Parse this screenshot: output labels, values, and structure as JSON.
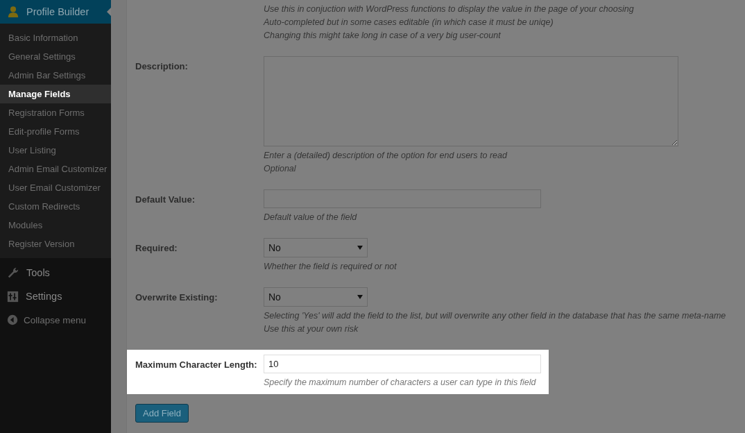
{
  "sidebar": {
    "header": {
      "label": "Profile Builder"
    },
    "items": [
      {
        "label": "Basic Information",
        "selected": false
      },
      {
        "label": "General Settings",
        "selected": false
      },
      {
        "label": "Admin Bar Settings",
        "selected": false
      },
      {
        "label": "Manage Fields",
        "selected": true
      },
      {
        "label": "Registration Forms",
        "selected": false
      },
      {
        "label": "Edit-profile Forms",
        "selected": false
      },
      {
        "label": "User Listing",
        "selected": false
      },
      {
        "label": "Admin Email Customizer",
        "selected": false
      },
      {
        "label": "User Email Customizer",
        "selected": false
      },
      {
        "label": "Custom Redirects",
        "selected": false
      },
      {
        "label": "Modules",
        "selected": false
      },
      {
        "label": "Register Version",
        "selected": false
      }
    ],
    "menu": [
      {
        "label": "Tools",
        "kind": "tools"
      },
      {
        "label": "Settings",
        "kind": "settings"
      },
      {
        "label": "Collapse menu",
        "kind": "collapse"
      }
    ]
  },
  "fields": [
    {
      "kind": "hints",
      "highlighted": false,
      "hints": [
        "Use this in conjuction with WordPress functions to display the value in the page of your choosing",
        "Auto-completed but in some cases editable (in which case it must be uniqe)",
        "Changing this might take long in case of a very big user-count"
      ]
    },
    {
      "kind": "textarea",
      "label": "Description:",
      "highlighted": false,
      "hints": [
        "Enter a (detailed) description of the option for end users to read",
        "Optional"
      ]
    },
    {
      "kind": "input",
      "label": "Default Value:",
      "highlighted": false,
      "hints": [
        "Default value of the field"
      ]
    },
    {
      "kind": "select",
      "label": "Required:",
      "value": "No",
      "highlighted": false,
      "hints": [
        "Whether the field is required or not"
      ]
    },
    {
      "kind": "select",
      "label": "Overwrite Existing:",
      "value": "No",
      "highlighted": false,
      "hints": [
        "Selecting 'Yes' will add the field to the list, but will overwrite any other field in the database that has the same meta-name",
        "Use this at your own risk"
      ]
    },
    {
      "kind": "input",
      "label": "Maximum Character Length:",
      "value": "10",
      "highlighted": true,
      "hints": [
        "Specify the maximum number of characters a user can type in this field"
      ]
    }
  ],
  "button": {
    "label": "Add Field"
  }
}
